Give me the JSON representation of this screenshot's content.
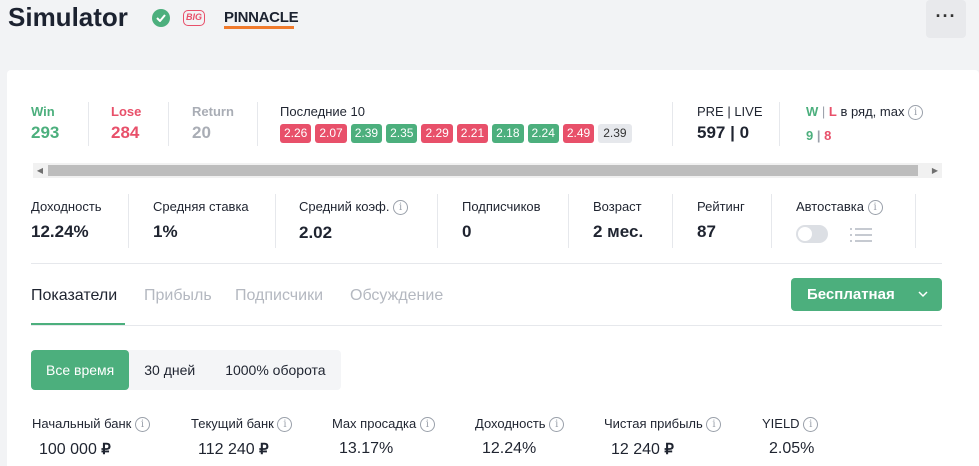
{
  "header": {
    "title": "Simulator",
    "big_badge": "BIG",
    "bookmaker": "PINNACLE",
    "more_label": "···"
  },
  "summary": {
    "win": {
      "label": "Win",
      "value": "293"
    },
    "lose": {
      "label": "Lose",
      "value": "284"
    },
    "return": {
      "label": "Return",
      "value": "20"
    },
    "last10_label": "Последние 10",
    "last10": [
      {
        "value": "2.26",
        "result": "lose"
      },
      {
        "value": "2.07",
        "result": "lose"
      },
      {
        "value": "2.39",
        "result": "win"
      },
      {
        "value": "2.35",
        "result": "win"
      },
      {
        "value": "2.29",
        "result": "lose"
      },
      {
        "value": "2.21",
        "result": "lose"
      },
      {
        "value": "2.18",
        "result": "win"
      },
      {
        "value": "2.24",
        "result": "win"
      },
      {
        "value": "2.49",
        "result": "lose"
      },
      {
        "value": "2.39",
        "result": "pending"
      }
    ],
    "prelive_label": "PRE | LIVE",
    "prelive_value": "597 | 0",
    "wl_w": "W",
    "wl_sep": " | ",
    "wl_l": "L",
    "wl_suffix": " в ряд, max",
    "wl_w_value": "9",
    "wl_l_value": "8"
  },
  "stats": [
    {
      "label": "Доходность",
      "value": "12.24%"
    },
    {
      "label": "Средняя ставка",
      "value": "1%"
    },
    {
      "label": "Средний коэф.",
      "value": "2.02"
    },
    {
      "label": "Подписчиков",
      "value": "0"
    },
    {
      "label": "Возраст",
      "value": "2 мес."
    },
    {
      "label": "Рейтинг",
      "value": "87"
    },
    {
      "label": "Автоставка",
      "value": ""
    }
  ],
  "tabs": [
    "Показатели",
    "Прибыль",
    "Подписчики",
    "Обсуждение"
  ],
  "free_button": "Бесплатная",
  "periods": [
    "Все время",
    "30 дней",
    "1000% оборота"
  ],
  "bank": [
    {
      "label": "Начальный банк",
      "value": "100 000",
      "currency": "₽"
    },
    {
      "label": "Текущий банк",
      "value": "112 240",
      "currency": "₽"
    },
    {
      "label": "Max просадка",
      "value": "13.17%",
      "currency": ""
    },
    {
      "label": "Доходность",
      "value": "12.24%",
      "currency": ""
    },
    {
      "label": "Чистая прибыль",
      "value": "12 240",
      "currency": "₽"
    },
    {
      "label": "YIELD",
      "value": "2.05%",
      "currency": ""
    }
  ],
  "colors": {
    "win": "#4caf7d",
    "lose": "#e8506a",
    "return": "#a9adb5",
    "accent": "#4caf7d"
  },
  "info_icon": "i"
}
